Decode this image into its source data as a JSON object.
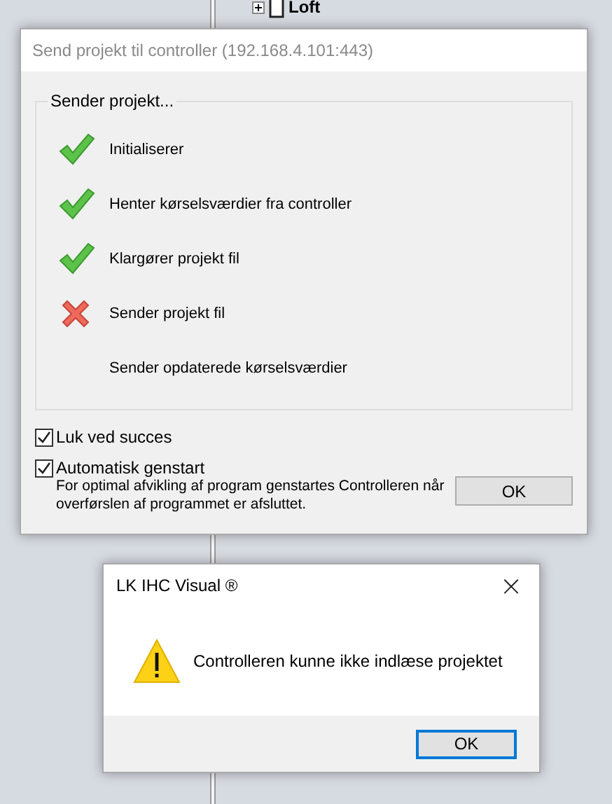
{
  "tree": {
    "items": [
      {
        "label": "Loft",
        "expanded": false
      }
    ]
  },
  "send_dialog": {
    "title": "Send projekt til controller (192.168.4.101:443)",
    "group_label": "Sender projekt...",
    "steps": [
      {
        "label": "Initialiserer",
        "kind": "done"
      },
      {
        "label": "Henter kørselsværdier fra controller",
        "kind": "done"
      },
      {
        "label": "Klargører projekt fil",
        "kind": "done"
      },
      {
        "label": "Sender projekt fil",
        "kind": "failed"
      },
      {
        "label": "Sender opdaterede kørselsværdier",
        "kind": "pending"
      }
    ],
    "close_on_success": {
      "label": "Luk ved succes",
      "checked": true
    },
    "auto_restart": {
      "label": "Automatisk genstart",
      "checked": true,
      "note": "For optimal afvikling af program genstartes Controlleren når overførslen af programmet er afsluttet."
    },
    "ok_button": "OK"
  },
  "message_box": {
    "title": "LK IHC Visual ®",
    "close": "×",
    "message": "Controlleren kunne ikke indlæse projektet",
    "ok_button": "OK"
  }
}
